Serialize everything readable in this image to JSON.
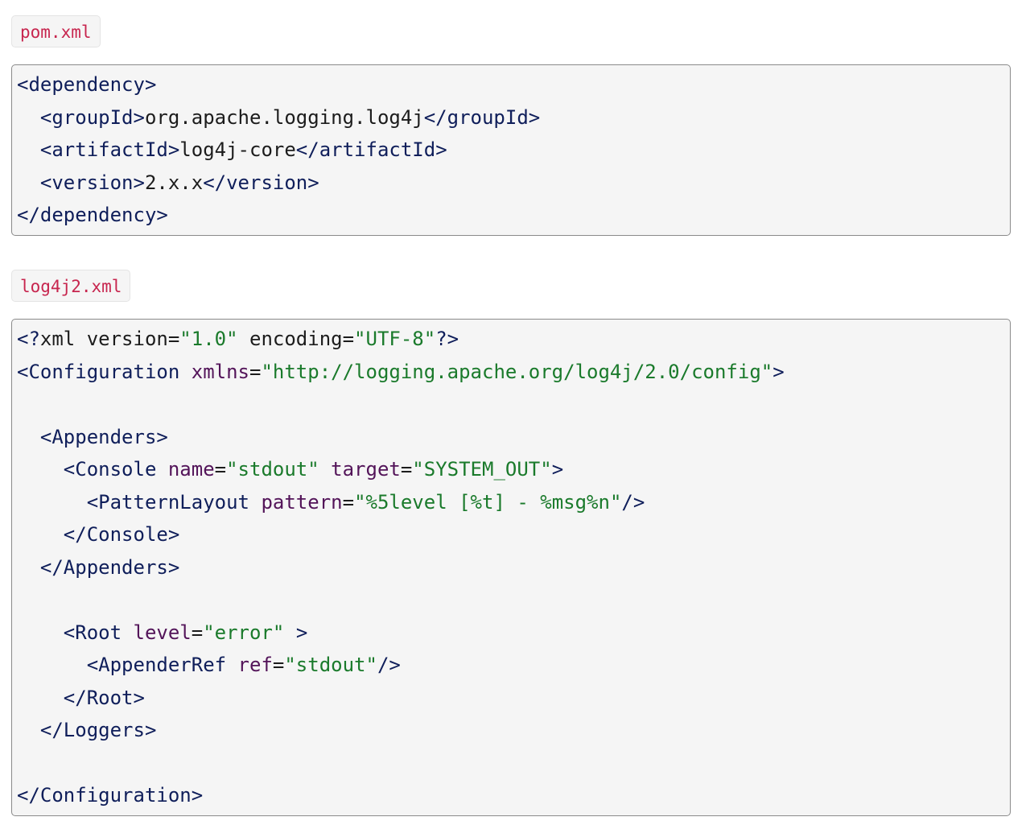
{
  "files": [
    {
      "label": "pom.xml",
      "lines": [
        [
          {
            "t": "tag",
            "v": "<dependency>"
          }
        ],
        [
          {
            "t": "txt",
            "v": "  "
          },
          {
            "t": "tag",
            "v": "<groupId>"
          },
          {
            "t": "txt",
            "v": "org.apache.logging.log4j"
          },
          {
            "t": "tag",
            "v": "</groupId>"
          }
        ],
        [
          {
            "t": "txt",
            "v": "  "
          },
          {
            "t": "tag",
            "v": "<artifactId>"
          },
          {
            "t": "txt",
            "v": "log4j-core"
          },
          {
            "t": "tag",
            "v": "</artifactId>"
          }
        ],
        [
          {
            "t": "txt",
            "v": "  "
          },
          {
            "t": "tag",
            "v": "<version>"
          },
          {
            "t": "txt",
            "v": "2.x.x"
          },
          {
            "t": "tag",
            "v": "</version>"
          }
        ],
        [
          {
            "t": "tag",
            "v": "</dependency>"
          }
        ]
      ]
    },
    {
      "label": "log4j2.xml",
      "lines": [
        [
          {
            "t": "tag",
            "v": "<?"
          },
          {
            "t": "txt",
            "v": "xml version="
          },
          {
            "t": "val",
            "v": "\"1.0\""
          },
          {
            "t": "txt",
            "v": " encoding="
          },
          {
            "t": "val",
            "v": "\"UTF-8\""
          },
          {
            "t": "tag",
            "v": "?>"
          }
        ],
        [
          {
            "t": "tag",
            "v": "<Configuration"
          },
          {
            "t": "txt",
            "v": " "
          },
          {
            "t": "attr",
            "v": "xmlns"
          },
          {
            "t": "txt",
            "v": "="
          },
          {
            "t": "val",
            "v": "\"http://logging.apache.org/log4j/2.0/config\""
          },
          {
            "t": "tag",
            "v": ">"
          }
        ],
        [],
        [
          {
            "t": "txt",
            "v": "  "
          },
          {
            "t": "tag",
            "v": "<Appenders>"
          }
        ],
        [
          {
            "t": "txt",
            "v": "    "
          },
          {
            "t": "tag",
            "v": "<Console"
          },
          {
            "t": "txt",
            "v": " "
          },
          {
            "t": "attr",
            "v": "name"
          },
          {
            "t": "txt",
            "v": "="
          },
          {
            "t": "val",
            "v": "\"stdout\""
          },
          {
            "t": "txt",
            "v": " "
          },
          {
            "t": "attr",
            "v": "target"
          },
          {
            "t": "txt",
            "v": "="
          },
          {
            "t": "val",
            "v": "\"SYSTEM_OUT\""
          },
          {
            "t": "tag",
            "v": ">"
          }
        ],
        [
          {
            "t": "txt",
            "v": "      "
          },
          {
            "t": "tag",
            "v": "<PatternLayout"
          },
          {
            "t": "txt",
            "v": " "
          },
          {
            "t": "attr",
            "v": "pattern"
          },
          {
            "t": "txt",
            "v": "="
          },
          {
            "t": "val",
            "v": "\"%5level [%t] - %msg%n\""
          },
          {
            "t": "tag",
            "v": "/>"
          }
        ],
        [
          {
            "t": "txt",
            "v": "    "
          },
          {
            "t": "tag",
            "v": "</Console>"
          }
        ],
        [
          {
            "t": "txt",
            "v": "  "
          },
          {
            "t": "tag",
            "v": "</Appenders>"
          }
        ],
        [],
        [
          {
            "t": "txt",
            "v": "    "
          },
          {
            "t": "tag",
            "v": "<Root"
          },
          {
            "t": "txt",
            "v": " "
          },
          {
            "t": "attr",
            "v": "level"
          },
          {
            "t": "txt",
            "v": "="
          },
          {
            "t": "val",
            "v": "\"error\""
          },
          {
            "t": "txt",
            "v": " "
          },
          {
            "t": "tag",
            "v": ">"
          }
        ],
        [
          {
            "t": "txt",
            "v": "      "
          },
          {
            "t": "tag",
            "v": "<AppenderRef"
          },
          {
            "t": "txt",
            "v": " "
          },
          {
            "t": "attr",
            "v": "ref"
          },
          {
            "t": "txt",
            "v": "="
          },
          {
            "t": "val",
            "v": "\"stdout\""
          },
          {
            "t": "tag",
            "v": "/>"
          }
        ],
        [
          {
            "t": "txt",
            "v": "    "
          },
          {
            "t": "tag",
            "v": "</Root>"
          }
        ],
        [
          {
            "t": "txt",
            "v": "  "
          },
          {
            "t": "tag",
            "v": "</Loggers>"
          }
        ],
        [],
        [
          {
            "t": "tag",
            "v": "</Configuration>"
          }
        ]
      ]
    }
  ]
}
